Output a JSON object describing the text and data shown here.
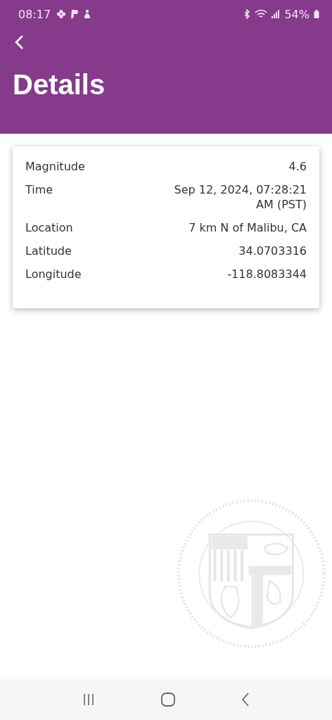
{
  "status_bar": {
    "time": "08:17",
    "battery": "54%"
  },
  "header": {
    "title": "Details"
  },
  "details": [
    {
      "label": "Magnitude",
      "value": "4.6"
    },
    {
      "label": "Time",
      "value": "Sep 12, 2024, 07:28:21 AM (PST)"
    },
    {
      "label": "Location",
      "value": "7 km N of Malibu, CA"
    },
    {
      "label": "Latitude",
      "value": "34.0703316"
    },
    {
      "label": "Longitude",
      "value": "-118.8083344"
    }
  ]
}
